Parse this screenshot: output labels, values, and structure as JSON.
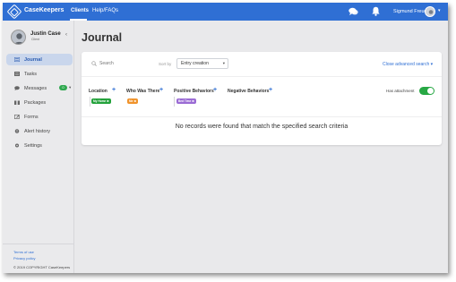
{
  "header": {
    "brand": "CaseKeepers",
    "nav": [
      {
        "label": "Clients"
      },
      {
        "label": "Help/FAQs"
      }
    ],
    "user_name": "Sigmund Freud",
    "brand_color": "#2f6fd4"
  },
  "sidebar": {
    "client_name": "Justin Case",
    "client_role": "Client",
    "items": [
      {
        "label": "Journal",
        "icon": "journal-icon",
        "active": true
      },
      {
        "label": "Tasks",
        "icon": "tasks-icon"
      },
      {
        "label": "Messages",
        "icon": "messages-icon",
        "badge": "0"
      },
      {
        "label": "Packages",
        "icon": "packages-icon"
      },
      {
        "label": "Forms",
        "icon": "forms-icon"
      },
      {
        "label": "Alert history",
        "icon": "alert-history-icon"
      },
      {
        "label": "Settings",
        "icon": "settings-icon"
      }
    ],
    "footer_links": [
      "Terms of use",
      "Privacy policy"
    ],
    "copyright": "© 2019 COPYRIGHT CaseKeepers"
  },
  "main": {
    "title": "Journal",
    "search": {
      "placeholder": "Search"
    },
    "sort": {
      "label": "Sort by",
      "value": "Entry creation"
    },
    "advanced_search_label": "Close advanced search",
    "filters": [
      {
        "label": "Location",
        "chip": {
          "label": "My Home",
          "color": "#23a13b"
        }
      },
      {
        "label": "Who Was There",
        "chip": {
          "label": "Me",
          "color": "#f0932b"
        }
      },
      {
        "label": "Positive Behaviors",
        "chip": {
          "label": "Bed Time",
          "color": "#9a6bd4"
        }
      },
      {
        "label": "Negative Behaviors"
      }
    ],
    "has_attachment": {
      "label": "Has attachment",
      "enabled": true
    },
    "empty_message": "No records were found that match the specified search criteria"
  }
}
